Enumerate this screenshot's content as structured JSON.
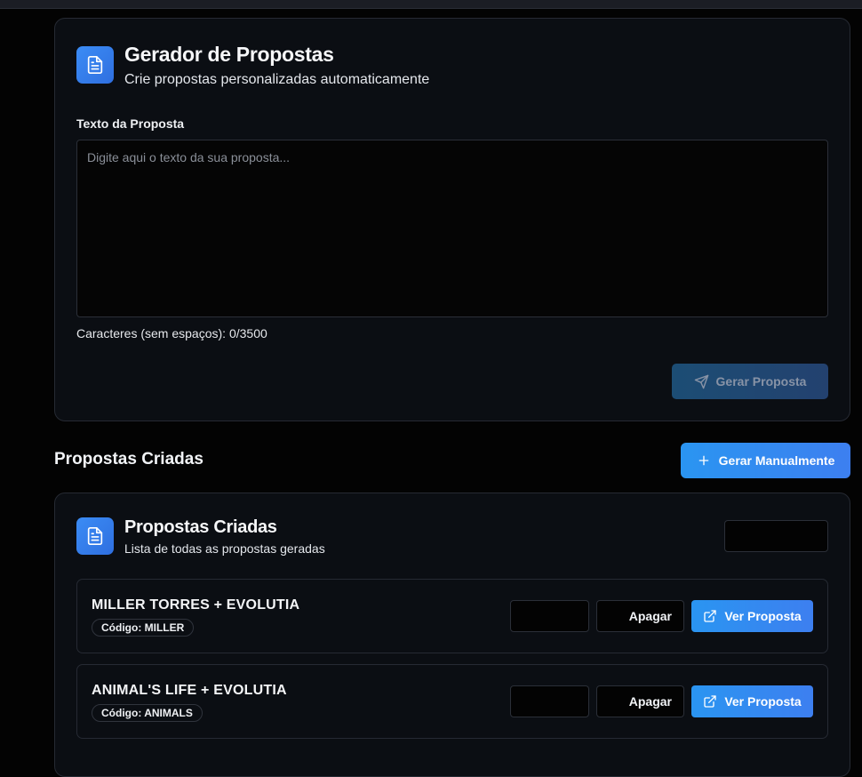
{
  "generator": {
    "title": "Gerador de Propostas",
    "subtitle": "Crie propostas personalizadas automaticamente",
    "text_label": "Texto da Proposta",
    "text_value": "",
    "text_placeholder": "Digite aqui o texto da sua proposta...",
    "counter": "Caracteres (sem espaços): 0/3500",
    "submit_label": "Gerar Proposta",
    "icon": "document-icon"
  },
  "section": {
    "title": "Propostas Criadas",
    "manual_button_label": "Gerar Manualmente"
  },
  "list": {
    "title": "Propostas Criadas",
    "subtitle": "Lista de todas as propostas geradas",
    "icon": "document-icon",
    "items": [
      {
        "name": "MILLER TORRES + EVOLUTIA",
        "code": "Código: MILLER",
        "delete_label": "Apagar",
        "view_label": "Ver Proposta"
      },
      {
        "name": "ANIMAL'S LIFE + EVOLUTIA",
        "code": "Código: ANIMALS",
        "delete_label": "Apagar",
        "view_label": "Ver Proposta"
      }
    ]
  },
  "colors": {
    "background": "#030303",
    "card": "#0b0e13",
    "accent": "#2a95f1",
    "accent_dark": "#3d7ff0",
    "disabled_button": "#1c4d74"
  }
}
